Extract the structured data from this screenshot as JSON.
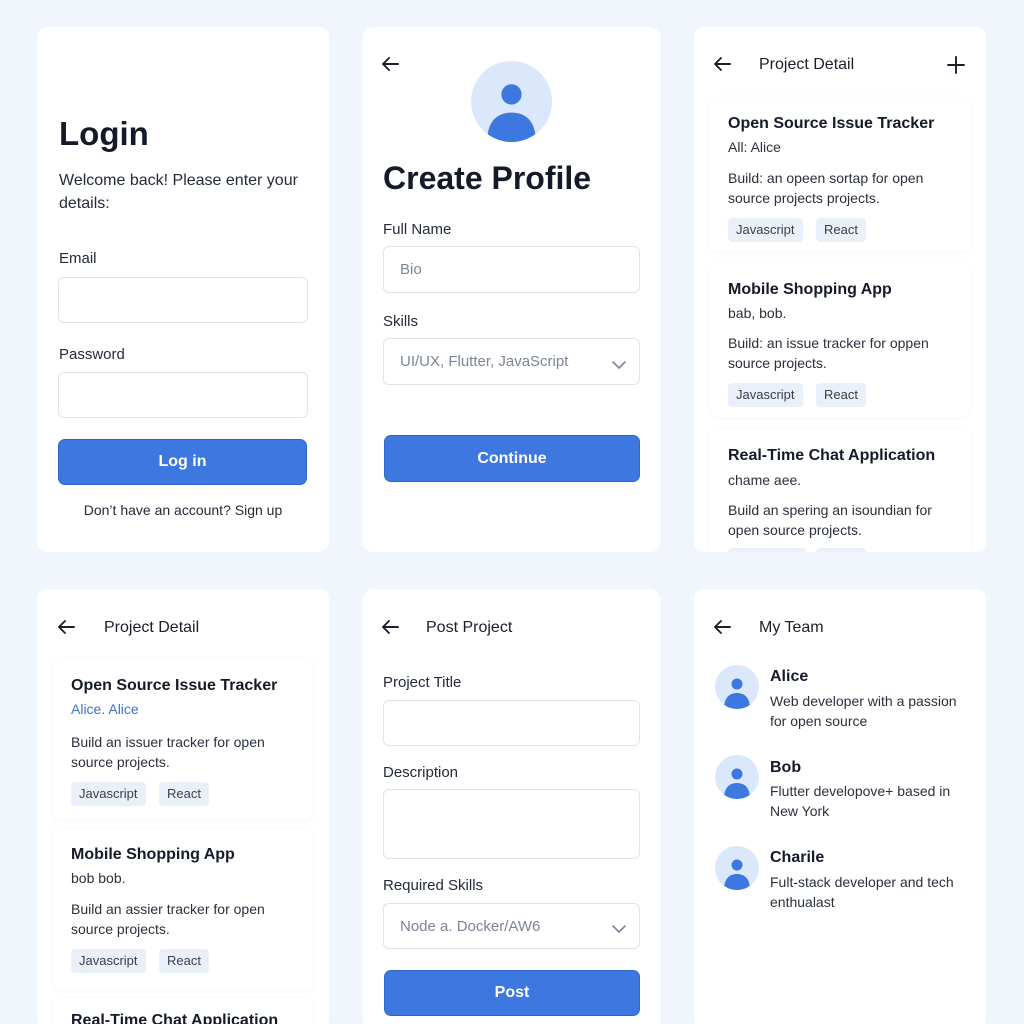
{
  "login": {
    "title": "Login",
    "subtitle": "Welcome back! Please enter your details:",
    "email_label": "Email",
    "email_value": "",
    "password_label": "Password",
    "password_value": "",
    "login_button": "Log in",
    "signup_text": "Don’t have an account? Sign up"
  },
  "profile": {
    "title": "Create Profile",
    "full_name_label": "Full Name",
    "full_name_placeholder": "Bio",
    "skills_label": "Skills",
    "skills_value": "UI/UX, Flutter, JavaScript",
    "continue_button": "Continue"
  },
  "detail1": {
    "header_title": "Project Detail",
    "cards": [
      {
        "title": "Open Source Issue Tracker",
        "subtitle": "All: Alice",
        "description": "Build: an opeen sortap for open source projects projects.",
        "tags": [
          "Javascript",
          "React"
        ]
      },
      {
        "title": "Mobile Shopping App",
        "subtitle": "bab, bob.",
        "description": "Build: an issue tracker for oppen source projects.",
        "tags": [
          "Javascript",
          "React"
        ]
      },
      {
        "title": "Real-Time Chat Application",
        "subtitle": "chame aee.",
        "description": "Build an spering an isoundian for open source projects.",
        "tags": []
      }
    ]
  },
  "detail2": {
    "header_title": "Project Detail",
    "cards": [
      {
        "title": "Open Source Issue Tracker",
        "subtitle": "Alice. Alice",
        "description": "Build an issuer tracker for open source projects.",
        "tags": [
          "Javascript",
          "React"
        ]
      },
      {
        "title": "Mobile Shopping App",
        "subtitle": "bob bob.",
        "description": "Build an assier tracker for open source projects.",
        "tags": [
          "Javascript",
          "React"
        ]
      },
      {
        "title": "Real-Time Chat Application"
      }
    ]
  },
  "post": {
    "header_title": "Post Project",
    "project_title_label": "Project Title",
    "project_title_value": "",
    "description_label": "Description",
    "description_value": "",
    "required_skills_label": "Required Skills",
    "required_skills_value": "Node a. Docker/AW6",
    "post_button": "Post"
  },
  "team": {
    "header_title": "My Team",
    "members": [
      {
        "name": "Alice",
        "bio": "Web developer with a passion for open source"
      },
      {
        "name": "Bob",
        "bio": "Flutter developove+ based in New York"
      },
      {
        "name": "Charile",
        "bio": "Fult-stack developer and tech enthualast"
      }
    ]
  },
  "colors": {
    "page_background": "#f1f5fc",
    "primary_button": "#3d78e0",
    "avatar_background": "#dbe7fb",
    "avatar_figure": "#3d78e0",
    "tag_background": "#eaf0f9",
    "link_text": "#3f72c9"
  },
  "icons": [
    "back-arrow-icon",
    "plus-icon",
    "user-avatar-icon",
    "chevron-down-icon"
  ]
}
